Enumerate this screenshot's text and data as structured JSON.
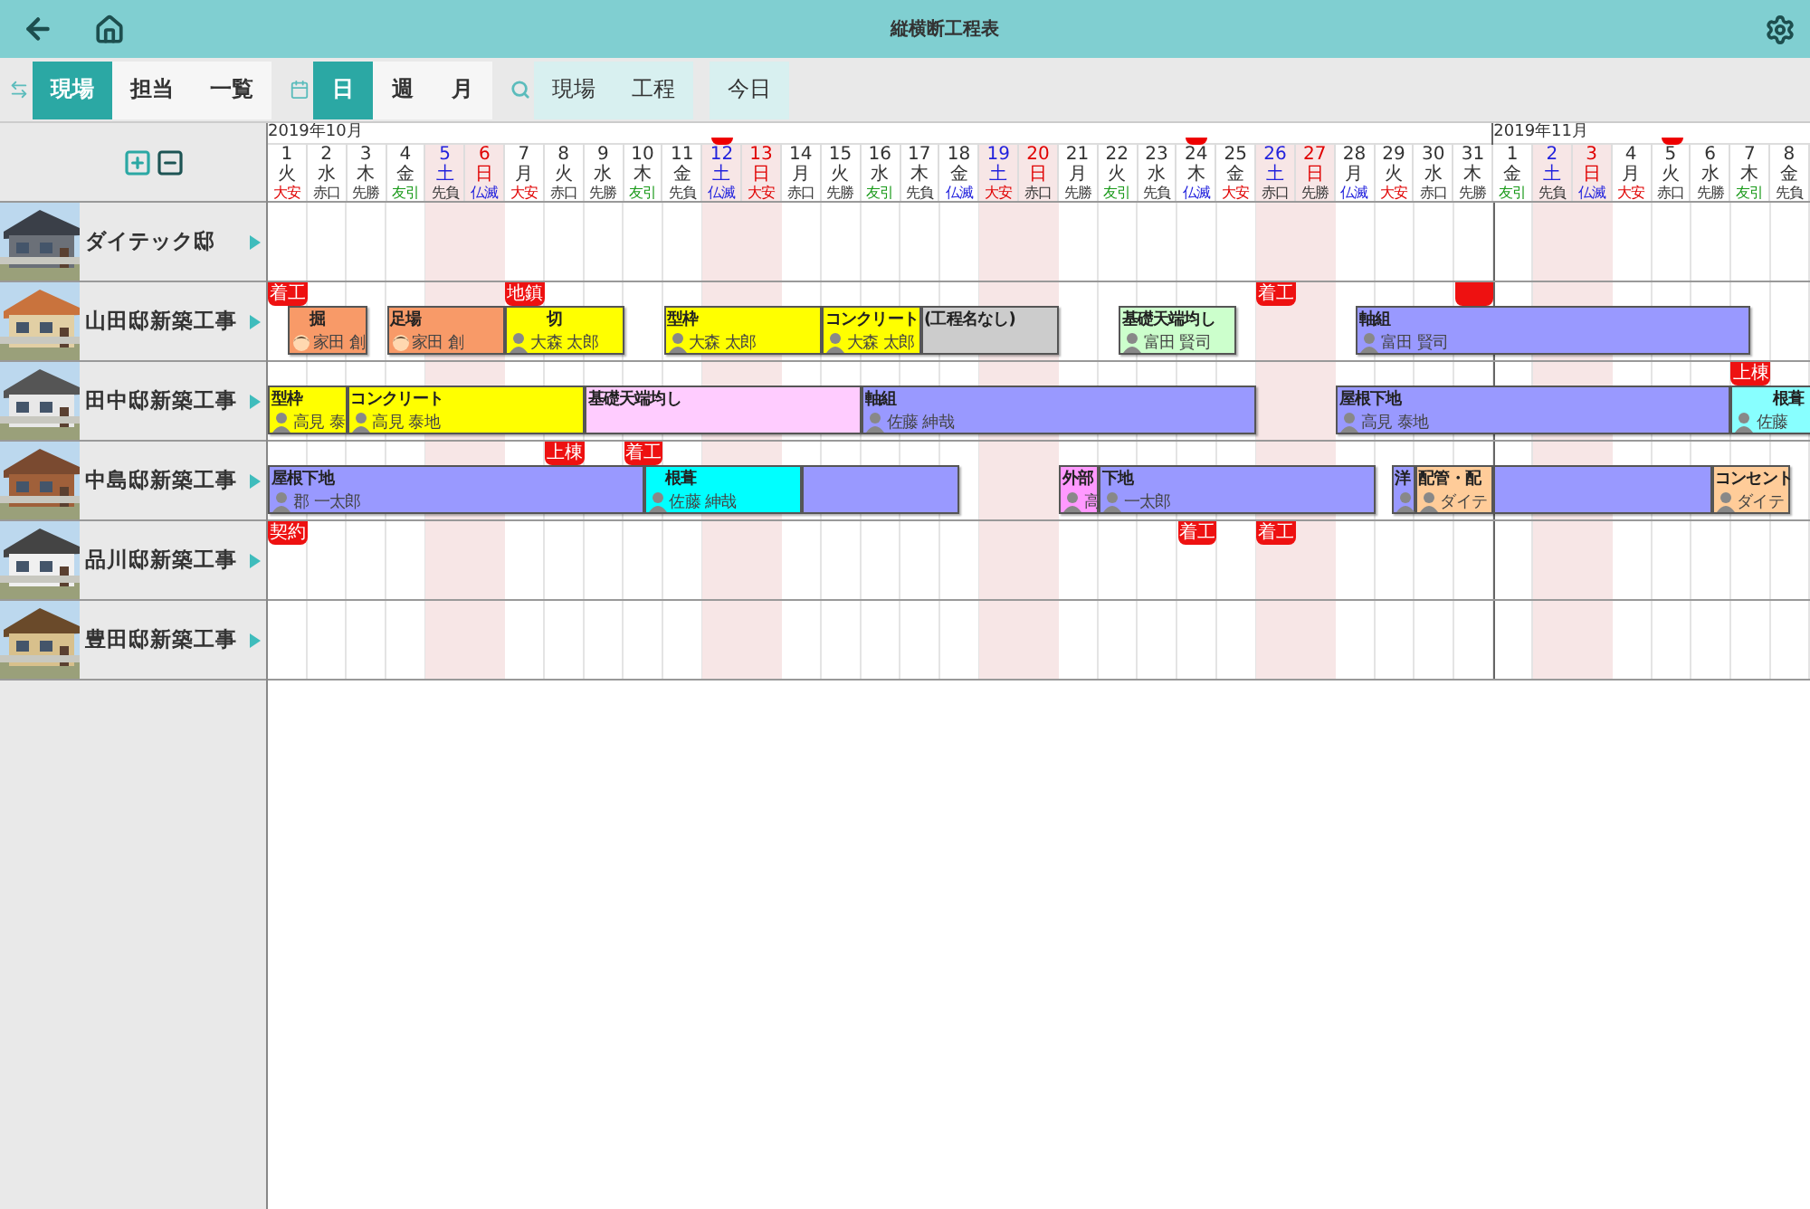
{
  "top_bar": {
    "title": "縦横断工程表"
  },
  "toolbar": {
    "view_modes": [
      {
        "label": "現場",
        "selected": true
      },
      {
        "label": "担当",
        "selected": false
      },
      {
        "label": "一覧",
        "selected": false
      }
    ],
    "scales": [
      {
        "label": "日",
        "selected": true
      },
      {
        "label": "週",
        "selected": false
      },
      {
        "label": "月",
        "selected": false
      }
    ],
    "search_buttons": [
      "現場",
      "工程"
    ],
    "today_button": "今日"
  },
  "timeline": {
    "months": [
      {
        "label": "2019年10月",
        "days": [
          {
            "n": "1",
            "wd": "火",
            "kind": "weekday",
            "rokuyo": "大安",
            "color": "#e00000",
            "flag": false
          },
          {
            "n": "2",
            "wd": "水",
            "kind": "weekday",
            "rokuyo": "赤口",
            "color": "#333333",
            "flag": false
          },
          {
            "n": "3",
            "wd": "木",
            "kind": "weekday",
            "rokuyo": "先勝",
            "color": "#333333",
            "flag": false
          },
          {
            "n": "4",
            "wd": "金",
            "kind": "weekday",
            "rokuyo": "友引",
            "color": "#1a9a1a",
            "flag": false
          },
          {
            "n": "5",
            "wd": "土",
            "kind": "saturday",
            "rokuyo": "先負",
            "color": "#333333",
            "flag": false
          },
          {
            "n": "6",
            "wd": "日",
            "kind": "sunday",
            "rokuyo": "仏滅",
            "color": "#2222dd",
            "flag": false
          },
          {
            "n": "7",
            "wd": "月",
            "kind": "weekday",
            "rokuyo": "大安",
            "color": "#e00000",
            "flag": false
          },
          {
            "n": "8",
            "wd": "火",
            "kind": "weekday",
            "rokuyo": "赤口",
            "color": "#333333",
            "flag": false
          },
          {
            "n": "9",
            "wd": "水",
            "kind": "weekday",
            "rokuyo": "先勝",
            "color": "#333333",
            "flag": false
          },
          {
            "n": "10",
            "wd": "木",
            "kind": "weekday",
            "rokuyo": "友引",
            "color": "#1a9a1a",
            "flag": false
          },
          {
            "n": "11",
            "wd": "金",
            "kind": "weekday",
            "rokuyo": "先負",
            "color": "#333333",
            "flag": false
          },
          {
            "n": "12",
            "wd": "土",
            "kind": "saturday",
            "rokuyo": "仏滅",
            "color": "#2222dd",
            "flag": true
          },
          {
            "n": "13",
            "wd": "日",
            "kind": "sunday",
            "rokuyo": "大安",
            "color": "#e00000",
            "flag": false
          },
          {
            "n": "14",
            "wd": "月",
            "kind": "weekday",
            "rokuyo": "赤口",
            "color": "#333333",
            "flag": false
          },
          {
            "n": "15",
            "wd": "火",
            "kind": "weekday",
            "rokuyo": "先勝",
            "color": "#333333",
            "flag": false
          },
          {
            "n": "16",
            "wd": "水",
            "kind": "weekday",
            "rokuyo": "友引",
            "color": "#1a9a1a",
            "flag": false
          },
          {
            "n": "17",
            "wd": "木",
            "kind": "weekday",
            "rokuyo": "先負",
            "color": "#333333",
            "flag": false
          },
          {
            "n": "18",
            "wd": "金",
            "kind": "weekday",
            "rokuyo": "仏滅",
            "color": "#2222dd",
            "flag": false
          },
          {
            "n": "19",
            "wd": "土",
            "kind": "saturday",
            "rokuyo": "大安",
            "color": "#e00000",
            "flag": false
          },
          {
            "n": "20",
            "wd": "日",
            "kind": "sunday",
            "rokuyo": "赤口",
            "color": "#333333",
            "flag": false
          },
          {
            "n": "21",
            "wd": "月",
            "kind": "weekday",
            "rokuyo": "先勝",
            "color": "#333333",
            "flag": false
          },
          {
            "n": "22",
            "wd": "火",
            "kind": "weekday",
            "rokuyo": "友引",
            "color": "#1a9a1a",
            "flag": false
          },
          {
            "n": "23",
            "wd": "水",
            "kind": "weekday",
            "rokuyo": "先負",
            "color": "#333333",
            "flag": false
          },
          {
            "n": "24",
            "wd": "木",
            "kind": "weekday",
            "rokuyo": "仏滅",
            "color": "#2222dd",
            "flag": true
          },
          {
            "n": "25",
            "wd": "金",
            "kind": "weekday",
            "rokuyo": "大安",
            "color": "#e00000",
            "flag": false
          },
          {
            "n": "26",
            "wd": "土",
            "kind": "saturday",
            "rokuyo": "赤口",
            "color": "#333333",
            "flag": false
          },
          {
            "n": "27",
            "wd": "日",
            "kind": "sunday",
            "rokuyo": "先勝",
            "color": "#333333",
            "flag": false
          },
          {
            "n": "28",
            "wd": "月",
            "kind": "weekday",
            "rokuyo": "仏滅",
            "color": "#2222dd",
            "flag": false
          },
          {
            "n": "29",
            "wd": "火",
            "kind": "weekday",
            "rokuyo": "大安",
            "color": "#e00000",
            "flag": false
          },
          {
            "n": "30",
            "wd": "水",
            "kind": "weekday",
            "rokuyo": "赤口",
            "color": "#333333",
            "flag": false
          },
          {
            "n": "31",
            "wd": "木",
            "kind": "weekday",
            "rokuyo": "先勝",
            "color": "#333333",
            "flag": false
          }
        ]
      },
      {
        "label": "2019年11月",
        "days": [
          {
            "n": "1",
            "wd": "金",
            "kind": "weekday",
            "rokuyo": "友引",
            "color": "#1a9a1a",
            "flag": false
          },
          {
            "n": "2",
            "wd": "土",
            "kind": "saturday",
            "rokuyo": "先負",
            "color": "#333333",
            "flag": false
          },
          {
            "n": "3",
            "wd": "日",
            "kind": "sunday",
            "rokuyo": "仏滅",
            "color": "#2222dd",
            "flag": false
          },
          {
            "n": "4",
            "wd": "月",
            "kind": "weekday",
            "rokuyo": "大安",
            "color": "#e00000",
            "flag": false
          },
          {
            "n": "5",
            "wd": "火",
            "kind": "weekday",
            "rokuyo": "赤口",
            "color": "#333333",
            "flag": true
          },
          {
            "n": "6",
            "wd": "水",
            "kind": "weekday",
            "rokuyo": "先勝",
            "color": "#333333",
            "flag": false
          },
          {
            "n": "7",
            "wd": "木",
            "kind": "weekday",
            "rokuyo": "友引",
            "color": "#1a9a1a",
            "flag": false
          },
          {
            "n": "8",
            "wd": "金",
            "kind": "weekday",
            "rokuyo": "先負",
            "color": "#333333",
            "flag": false
          }
        ]
      }
    ]
  },
  "sites": [
    {
      "name": "ダイテック邸",
      "kind": "picture"
    },
    {
      "name": "山田邸新築工事",
      "kind": "picture",
      "tasks": [
        {
          "label": "掘",
          "color": "#f89a68",
          "person": {
            "name": "家田 創",
            "kind": "cartoon"
          }
        },
        {
          "label": "足場",
          "color": "#f89a68",
          "person": {
            "name": "家田 創",
            "kind": "cartoon"
          }
        },
        {
          "label": "切",
          "color": "#ffff00",
          "person": {
            "name": "大森 太郎",
            "kind": "silhouette"
          }
        },
        {
          "label": "型枠",
          "color": "#ffff00",
          "person": {
            "name": "大森 太郎",
            "kind": "silhouette"
          }
        },
        {
          "label": "コンクリート",
          "color": "#ffff00",
          "person": {
            "name": "大森 太郎",
            "kind": "silhouette"
          }
        },
        {
          "label": "(工程名なし)",
          "color": "#cccccc"
        },
        {
          "label": "基礎天端均し",
          "color": "#ccffcc",
          "person": {
            "name": "富田 賢司",
            "kind": "silhouette"
          }
        },
        {
          "label": "軸組",
          "color": "#9999ff",
          "person": {
            "name": "富田 賢司",
            "kind": "silhouette"
          }
        }
      ],
      "markers": [
        {
          "kind": "labeled",
          "label": "着工"
        },
        {
          "kind": "labeled",
          "label": "地鎮"
        },
        {
          "kind": "labeled",
          "label": "着工"
        },
        {
          "kind": "plain"
        }
      ]
    },
    {
      "name": "田中邸新築工事",
      "kind": "picture",
      "tasks": [
        {
          "label": "型枠",
          "color": "#ffff00",
          "person": {
            "name": "高見 泰",
            "kind": "silhouette"
          }
        },
        {
          "label": "コンクリート",
          "color": "#ffff00",
          "person": {
            "name": "高見 泰地",
            "kind": "silhouette"
          }
        },
        {
          "label": "基礎天端均し",
          "color": "#ffccff"
        },
        {
          "label": "軸組",
          "color": "#9999ff",
          "person": {
            "name": "佐藤 紳哉",
            "kind": "silhouette"
          }
        },
        {
          "label": "屋根下地",
          "color": "#9999ff",
          "person": {
            "name": "高見 泰地",
            "kind": "silhouette"
          }
        },
        {
          "label": "根葺",
          "color": "#88ffff",
          "person": {
            "name": "佐藤",
            "kind": "silhouette"
          }
        }
      ],
      "markers": [
        {
          "kind": "labeled",
          "label": "上棟"
        }
      ]
    },
    {
      "name": "中島邸新築工事",
      "kind": "picture",
      "tasks": [
        {
          "label": "屋根下地",
          "color": "#9999ff",
          "person": {
            "name": "郡 一太郎",
            "kind": "silhouette"
          }
        },
        {
          "label": "根葺",
          "color": "#00ffff",
          "person": {
            "name": "佐藤 紳哉",
            "kind": "silhouette"
          }
        },
        {
          "color": "#9999ff"
        },
        {
          "label": "外部",
          "color": "#ff99ff",
          "person": {
            "name": "高",
            "kind": "silhouette"
          }
        },
        {
          "label": "下地",
          "color": "#9999ff",
          "person": {
            "name": "一太郎",
            "kind": "silhouette"
          }
        },
        {
          "label": "洋",
          "color": "#9999ff",
          "person": {
            "kind": "silhouette"
          }
        },
        {
          "label": "配管・配",
          "color": "#ffcc99",
          "person": {
            "name": "ダイテ",
            "kind": "silhouette"
          }
        },
        {
          "color": "#9999ff"
        },
        {
          "label": "コンセント",
          "color": "#ffcc99",
          "person": {
            "name": "ダイテ",
            "kind": "silhouette"
          }
        }
      ],
      "markers": [
        {
          "kind": "labeled",
          "label": "上棟"
        },
        {
          "kind": "labeled",
          "label": "着工"
        }
      ]
    },
    {
      "name": "品川邸新築工事",
      "kind": "picture",
      "markers": [
        {
          "kind": "labeled",
          "label": "契約"
        },
        {
          "kind": "labeled",
          "label": "着工"
        },
        {
          "kind": "labeled",
          "label": "着工"
        }
      ]
    },
    {
      "name": "豊田邸新築工事",
      "kind": "picture"
    }
  ]
}
